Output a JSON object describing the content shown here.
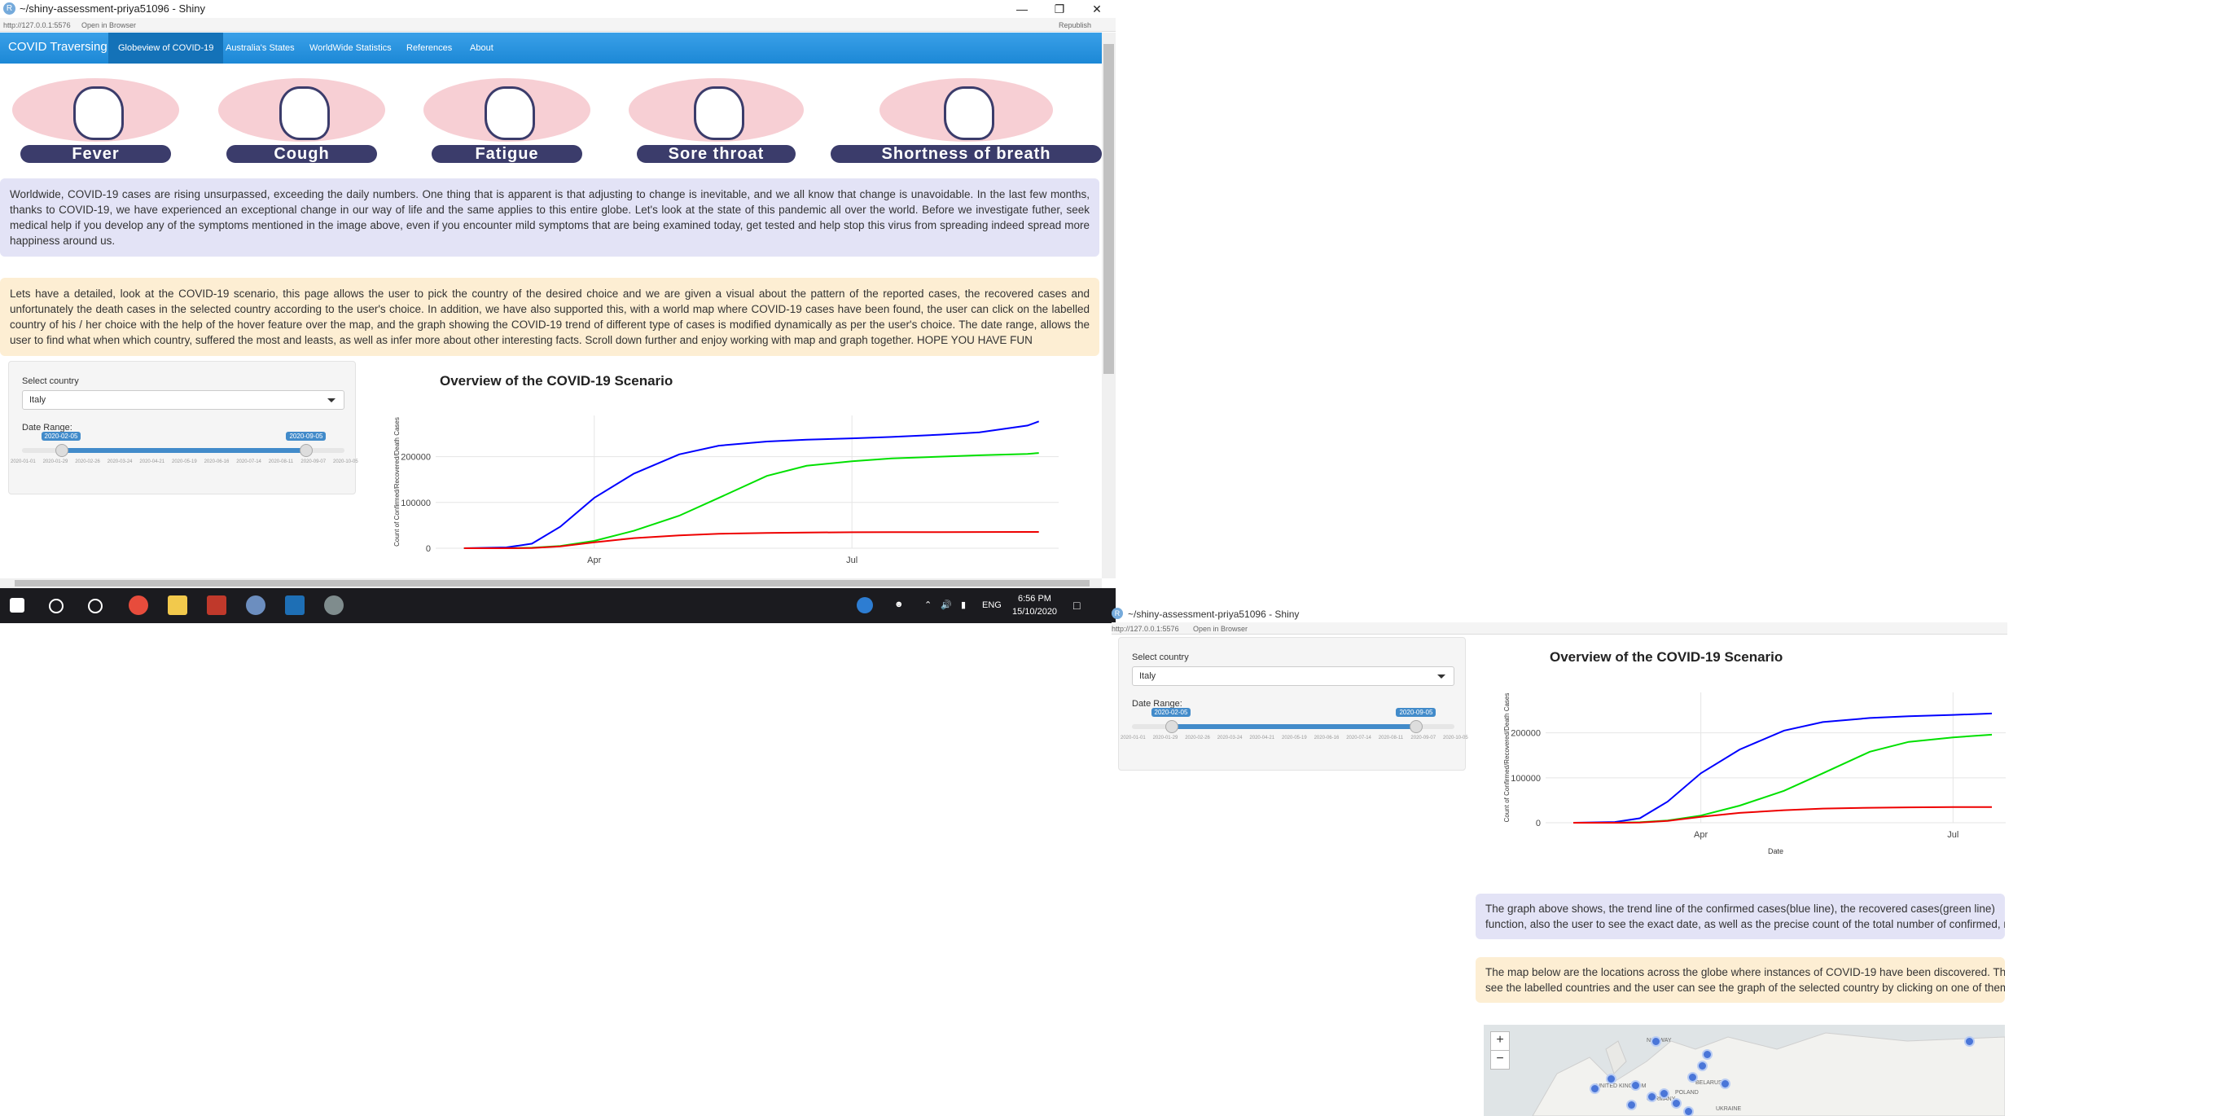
{
  "window": {
    "title": "~/shiny-assessment-priya51096 - Shiny",
    "url": "http://127.0.0.1:5576",
    "open_in_browser": "Open in Browser",
    "republish": "Republish"
  },
  "navbar": {
    "brand": "COVID Traversing",
    "items": [
      "Globeview of COVID-19",
      "Australia's States",
      "WorldWide Statistics",
      "References",
      "About"
    ],
    "active": "Globeview of COVID-19"
  },
  "symptoms": [
    "Fever",
    "Cough",
    "Fatigue",
    "Sore throat",
    "Shortness of breath"
  ],
  "intro_text": "Worldwide, COVID-19 cases are rising unsurpassed, exceeding the daily numbers. One thing that is apparent is that adjusting to change is inevitable, and we all know that change is unavoidable. In the last few months, thanks to COVID-19, we have experienced an exceptional change in our way of life and the same applies to this entire globe. Let's look at the state of this pandemic all over the world. Before we investigate futher, seek medical help if you develop any of the symptoms mentioned in the image above, even if you encounter mild symptoms that are being examined today, get tested and help stop this virus from spreading indeed spread more happiness around us.",
  "detail_text": "Lets have a detailed, look at the COVID-19 scenario, this page allows the user to pick the country of the desired choice and we are given a visual about the pattern of the reported cases, the recovered cases and unfortunately the death cases in the selected country according to the user's choice. In addition, we have also supported this, with a world map where COVID-19 cases have been found, the user can click on the labelled country of his / her choice with the help of the hover feature over the map, and the graph showing the COVID-19 trend of different type of cases is modified dynamically as per the user's choice. The date range, allows the user to find what when which country, suffered the most and leasts, as well as infer more about other interesting facts. Scroll down further and enjoy working with map and graph together. HOPE YOU HAVE FUN",
  "sidebar": {
    "country_label": "Select country",
    "country_value": "Italy",
    "date_label": "Date Range:",
    "date_from": "2020-02-05",
    "date_to": "2020-09-05",
    "ticks": [
      "2020-01-01",
      "2020-01-29",
      "2020-02-26",
      "2020-03-24",
      "2020-04-21",
      "2020-05-19",
      "2020-06-16",
      "2020-07-14",
      "2020-08-11",
      "2020-09-07",
      "2020-10-05"
    ],
    "range_fraction": [
      0.12,
      0.88
    ]
  },
  "graph_caption": "The graph above shows, the trend line of the confirmed cases(blue line), the recovered cases(green line)",
  "graph_caption_2": "function, also the user to see the exact date, as well as the precise count of the total number of confirmed, re",
  "map_caption": "The map below are the locations across the globe where instances of COVID-19 have been discovered. Th",
  "map_caption_2": "see the labelled countries and the user can see the graph of the selected country by clicking on one of them",
  "map_controls": {
    "zoom_in": "+",
    "zoom_out": "−"
  },
  "map_labels": [
    "UNITED KINGDOM",
    "BELARUS",
    "UKRAINE",
    "GERMANY",
    "POLAND",
    "NORWAY"
  ],
  "taskbar": {
    "language": "ENG",
    "time": "6:56 PM",
    "date": "15/10/2020"
  },
  "colors": {
    "confirmed": "#0000ff",
    "recovered": "#00e000",
    "deaths": "#ee0000",
    "navbar": "#1c88d6"
  },
  "chart_data": [
    {
      "type": "line",
      "title": "Overview of the COVID-19 Scenario",
      "xlabel": "",
      "ylabel": "Count of Confirmed/Recovered/Death Cases",
      "x_ticks": [
        "Apr",
        "Jul"
      ],
      "y_ticks": [
        0,
        100000,
        200000
      ],
      "ylim": [
        0,
        290000
      ],
      "x": [
        "2020-02-15",
        "2020-03-01",
        "2020-03-10",
        "2020-03-20",
        "2020-04-01",
        "2020-04-15",
        "2020-05-01",
        "2020-05-15",
        "2020-06-01",
        "2020-06-15",
        "2020-07-01",
        "2020-07-15",
        "2020-08-01",
        "2020-08-15",
        "2020-09-01",
        "2020-09-05"
      ],
      "series": [
        {
          "color": "#0000ff",
          "values": [
            0,
            1700,
            10000,
            47000,
            110000,
            163000,
            205000,
            224000,
            233000,
            237000,
            240000,
            243000,
            248000,
            253000,
            268000,
            277000
          ]
        },
        {
          "color": "#00e000",
          "values": [
            0,
            80,
            1000,
            5000,
            16000,
            38000,
            71000,
            110000,
            158000,
            180000,
            190000,
            196000,
            200000,
            203000,
            206000,
            208000
          ]
        },
        {
          "color": "#ee0000",
          "values": [
            0,
            30,
            500,
            4000,
            13000,
            22000,
            28000,
            31500,
            33400,
            34300,
            34800,
            35000,
            35200,
            35400,
            35500,
            35550
          ]
        }
      ]
    },
    {
      "type": "line",
      "title": "Overview of the COVID-19 Scenario",
      "xlabel": "Date",
      "ylabel": "Count of Confirmed/Recovered/Death Cases",
      "x_ticks": [
        "Apr",
        "Jul"
      ],
      "y_ticks": [
        0,
        100000,
        200000
      ],
      "ylim": [
        0,
        290000
      ],
      "x": [
        "2020-02-15",
        "2020-03-01",
        "2020-03-10",
        "2020-03-20",
        "2020-04-01",
        "2020-04-15",
        "2020-05-01",
        "2020-05-15",
        "2020-06-01",
        "2020-06-15",
        "2020-07-01",
        "2020-07-15"
      ],
      "series": [
        {
          "color": "#0000ff",
          "values": [
            0,
            1700,
            10000,
            47000,
            110000,
            163000,
            205000,
            224000,
            233000,
            237000,
            240000,
            243000
          ]
        },
        {
          "color": "#00e000",
          "values": [
            0,
            80,
            1000,
            5000,
            16000,
            38000,
            71000,
            110000,
            158000,
            180000,
            190000,
            196000
          ]
        },
        {
          "color": "#ee0000",
          "values": [
            0,
            30,
            500,
            4000,
            13000,
            22000,
            28000,
            31500,
            33400,
            34300,
            34800,
            35000
          ]
        }
      ]
    }
  ]
}
